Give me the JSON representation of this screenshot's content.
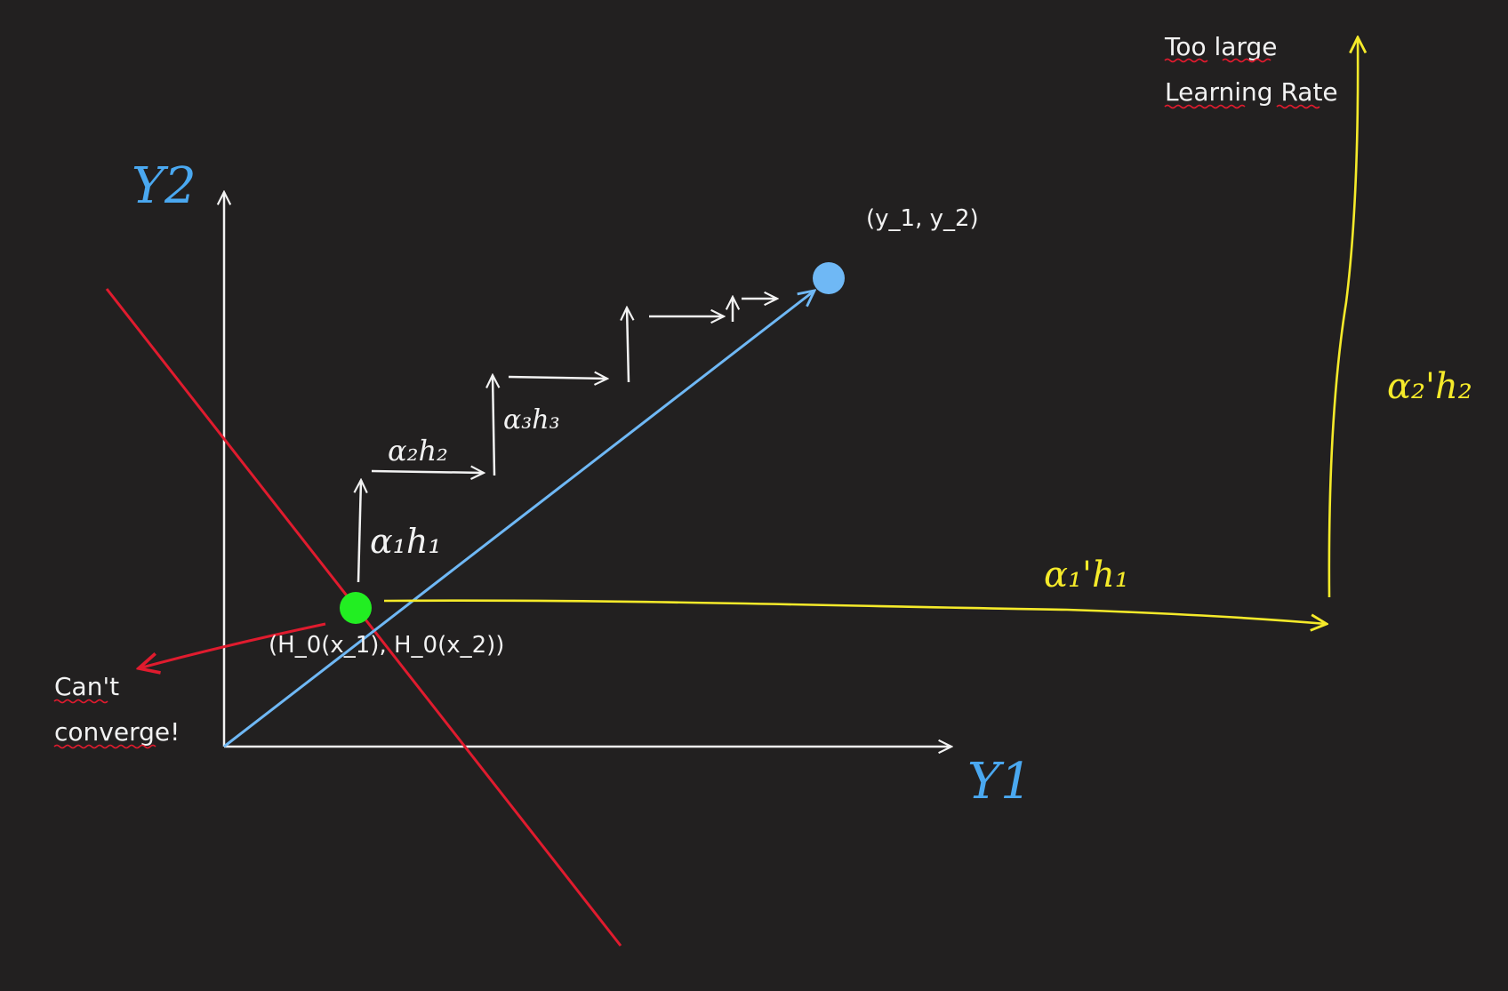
{
  "axes": {
    "y2_label": "Y2",
    "y1_label": "Y1"
  },
  "points": {
    "target_label": "(y_1, y_2)",
    "start_label": "(H_0(x_1), H_0(x_2))"
  },
  "steps": {
    "step1_label": "α₁h₁",
    "step2_label": "α₂h₂",
    "step3_label": "α₃h₃"
  },
  "overshoot": {
    "horizontal_label": "α₁'h₁",
    "vertical_label": "α₂'h₂",
    "note_line1": "Too large",
    "note_line2": "Learning Rate"
  },
  "divergence": {
    "note_line1": "Can't",
    "note_line2": "converge!"
  },
  "colors": {
    "background": "#222020",
    "axis": "#f2f2f2",
    "path": "#6fb8f5",
    "target_point": "#6fb8f5",
    "start_point": "#22ee22",
    "overshoot": "#f5ea2a",
    "diverge": "#e01b2e",
    "axis_label": "#4aa8f0"
  }
}
